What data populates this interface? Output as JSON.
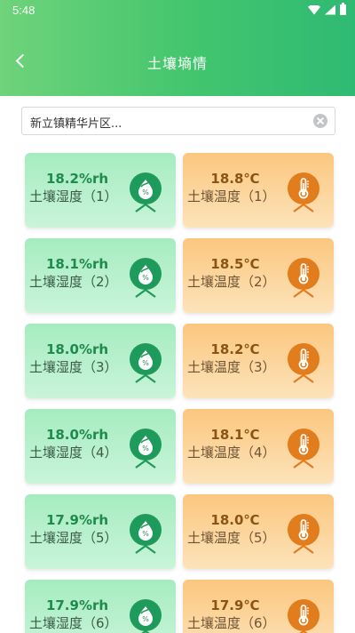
{
  "status_bar": {
    "time": "5:48"
  },
  "header": {
    "title": "土壤墒情"
  },
  "search": {
    "value": "新立镇精华片区..."
  },
  "colors": {
    "header_start": "#6fd37a",
    "header_end": "#2fba73",
    "humidity_icon": "#1e9a5a",
    "temperature_icon": "#e27d1e"
  },
  "cards": [
    {
      "humidity": {
        "value": "18.2%rh",
        "label": "土壤湿度（1）"
      },
      "temperature": {
        "value": "18.8℃",
        "label": "土壤温度（1）"
      }
    },
    {
      "humidity": {
        "value": "18.1%rh",
        "label": "土壤湿度（2）"
      },
      "temperature": {
        "value": "18.5℃",
        "label": "土壤温度（2）"
      }
    },
    {
      "humidity": {
        "value": "18.0%rh",
        "label": "土壤湿度（3）"
      },
      "temperature": {
        "value": "18.2℃",
        "label": "土壤温度（3）"
      }
    },
    {
      "humidity": {
        "value": "18.0%rh",
        "label": "土壤湿度（4）"
      },
      "temperature": {
        "value": "18.1℃",
        "label": "土壤温度（4）"
      }
    },
    {
      "humidity": {
        "value": "17.9%rh",
        "label": "土壤湿度（5）"
      },
      "temperature": {
        "value": "18.0℃",
        "label": "土壤温度（5）"
      }
    },
    {
      "humidity": {
        "value": "17.9%rh",
        "label": "土壤湿度（6）"
      },
      "temperature": {
        "value": "17.9℃",
        "label": "土壤温度（6）"
      }
    }
  ]
}
